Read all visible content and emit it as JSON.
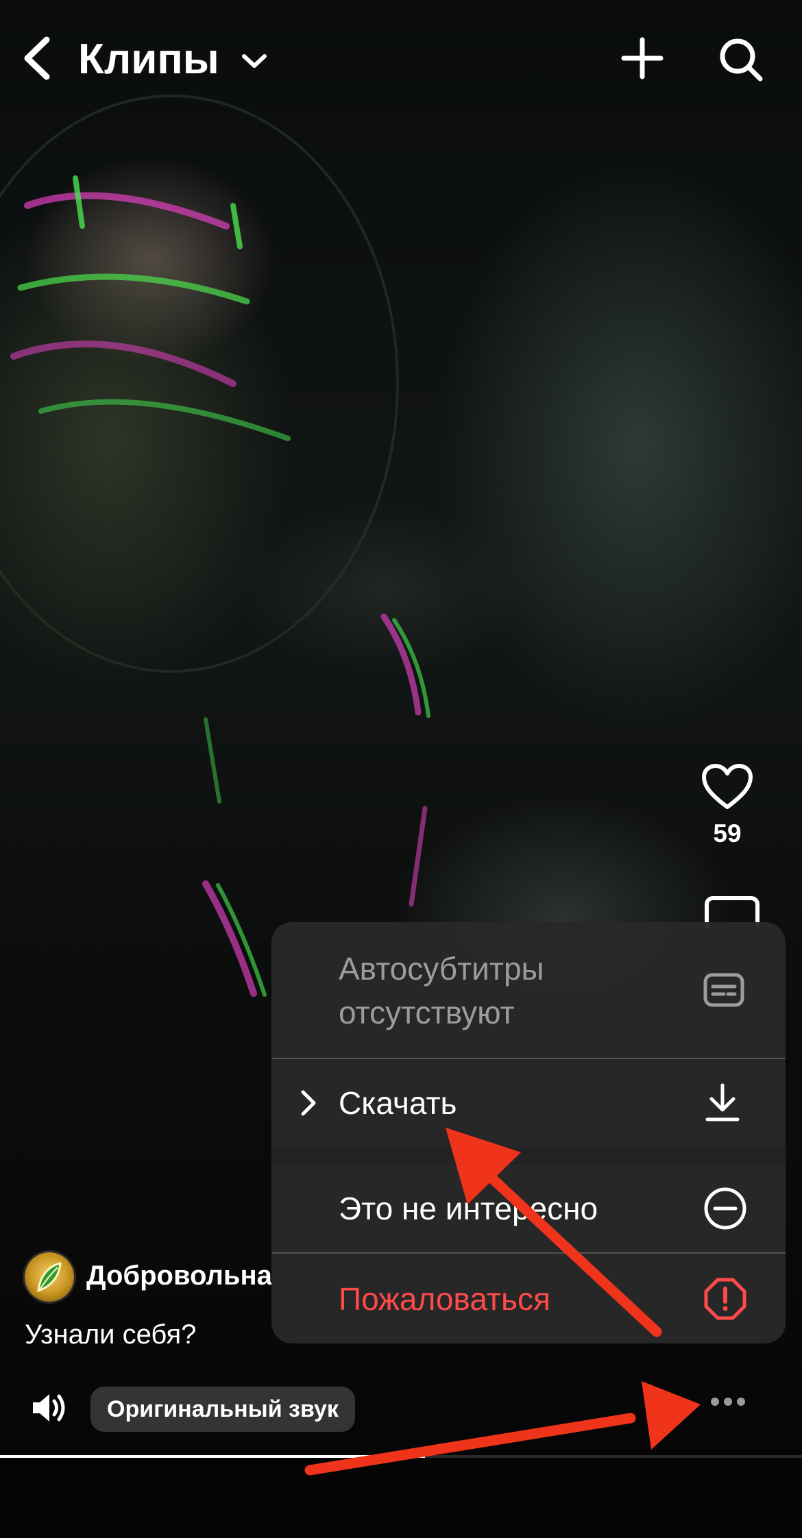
{
  "header": {
    "title": "Клипы"
  },
  "rail": {
    "like_count": "59"
  },
  "post": {
    "author": "Добровольна",
    "caption": "Узнали себя?",
    "sound_label": "Оригинальный звук",
    "progress_fraction": 0.53
  },
  "menu": {
    "items": [
      {
        "label": "Автосубтитры отсутствуют",
        "icon": "subtitles-icon",
        "enabled": false
      },
      {
        "label": "Скачать",
        "icon": "download-icon"
      },
      {
        "label": "Это не интересно",
        "icon": "minus-circle-icon"
      },
      {
        "label": "Пожаловаться",
        "icon": "report-octagon-icon"
      }
    ]
  },
  "colors": {
    "accent_red": "#ff4a4a",
    "annotation_arrow": "#f0341c",
    "menu_background": "#282828"
  }
}
